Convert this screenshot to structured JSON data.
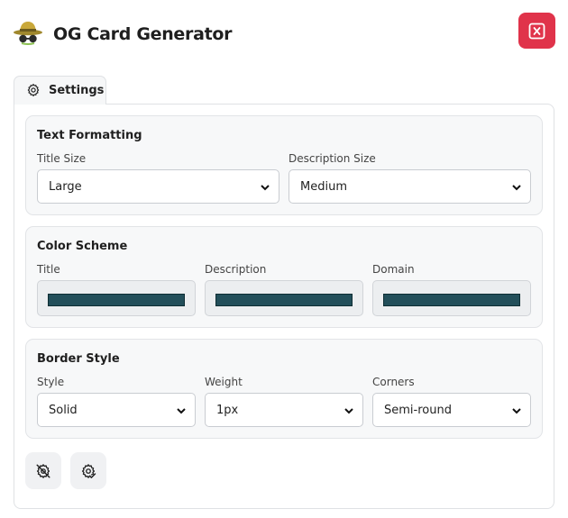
{
  "header": {
    "title": "OG Card Generator",
    "logo_icon": "spy-hat-glasses-icon",
    "close_icon": "close-x-icon",
    "close_color": "#e0334a"
  },
  "tabs": [
    {
      "label": "Settings",
      "icon": "gear-icon",
      "active": true
    }
  ],
  "sections": {
    "text_formatting": {
      "title": "Text Formatting",
      "title_size": {
        "label": "Title Size",
        "value": "Large"
      },
      "description_size": {
        "label": "Description Size",
        "value": "Medium"
      }
    },
    "color_scheme": {
      "title": "Color Scheme",
      "title_color": {
        "label": "Title",
        "value": "#234f5a"
      },
      "description_color": {
        "label": "Description",
        "value": "#234f5a"
      },
      "domain_color": {
        "label": "Domain",
        "value": "#234f5a"
      }
    },
    "border_style": {
      "title": "Border Style",
      "style": {
        "label": "Style",
        "value": "Solid"
      },
      "weight": {
        "label": "Weight",
        "value": "1px"
      },
      "corners": {
        "label": "Corners",
        "value": "Semi-round"
      }
    }
  },
  "footer_buttons": [
    {
      "icon": "gear-off-icon"
    },
    {
      "icon": "gear-check-icon"
    }
  ]
}
